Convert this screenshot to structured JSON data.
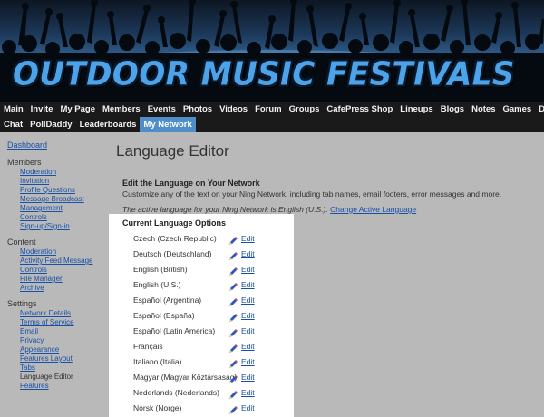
{
  "header": {
    "site_title": "Outdoor Music Festivals"
  },
  "nav": {
    "row1": [
      "Main",
      "Invite",
      "My Page",
      "Members",
      "Events",
      "Photos",
      "Videos",
      "Forum",
      "Groups",
      "CafePress Shop",
      "Lineups",
      "Blogs",
      "Notes",
      "Games",
      "Donate"
    ],
    "row2": [
      "Chat",
      "PollDaddy",
      "Leaderboards",
      "My Network"
    ],
    "active": "My Network",
    "active_color": "#4f8ec9"
  },
  "sidebar": {
    "dashboard": "Dashboard",
    "members_heading": "Members",
    "members_items": [
      "Moderation",
      "Invitation",
      "Profile Questions",
      "Message Broadcast",
      "Management",
      "Controls",
      "Sign-up/Sign-in"
    ],
    "content_heading": "Content",
    "content_items": [
      "Moderation",
      "Activity Feed Message",
      "Controls",
      "File Manager",
      "Archive"
    ],
    "settings_heading": "Settings",
    "settings_items": [
      "Network Details",
      "Terms of Service",
      "Email",
      "Privacy",
      "Appearance",
      "Features Layout",
      "Tabs",
      "Language Editor",
      "Features"
    ],
    "settings_current": "Language Editor"
  },
  "main": {
    "page_title": "Language Editor",
    "section_heading": "Edit the Language on Your Network",
    "section_desc": "Customize any of the text on your Ning Network, including tab names, email footers, error messages and more.",
    "active_language_text": "The active language for your Ning Network is English (U.S.).",
    "change_link": "Change Active Language"
  },
  "languages": {
    "heading": "Current Language Options",
    "edit_label": "Edit",
    "items": [
      "Czech (Czech Republic)",
      "Deutsch (Deutschland)",
      "English (British)",
      "English (U.S.)",
      "Español (Argentina)",
      "Español (España)",
      "Español (Latin America)",
      "Français",
      "Italiano (Italia)",
      "Magyar (Magyar Köztársaság)",
      "Nederlands (Nederlands)",
      "Norsk (Norge)"
    ]
  },
  "colors": {
    "link": "#1750a8",
    "nav_bg": "#1a1a1a",
    "page_bg": "#b9b9b9",
    "title_blue": "#4da3ea"
  },
  "icons": {
    "edit": "pencil-icon"
  }
}
